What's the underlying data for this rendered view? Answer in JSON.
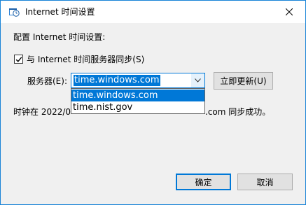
{
  "window": {
    "title": "Internet 时间设置",
    "close_icon": "close-icon",
    "app_icon": "clock-settings-icon"
  },
  "section": {
    "heading": "配置 Internet 时间设置:"
  },
  "sync": {
    "checkbox_checked": true,
    "checkbox_label": "与 Internet 时间服务器同步(S)"
  },
  "server": {
    "label": "服务器(E):",
    "value": "time.windows.com",
    "options": [
      "time.windows.com",
      "time.nist.gov"
    ],
    "selected_index": 0,
    "update_button": "立即更新(U)"
  },
  "status": {
    "visible_prefix": "时钟在 2022/0",
    "visible_suffix": ".com 同步成功。"
  },
  "buttons": {
    "ok": "确定",
    "cancel": "取消"
  },
  "colors": {
    "accent": "#0078d7",
    "window_border": "#1883d7",
    "dialog_bg": "#f0f0f0",
    "button_bg": "#e1e1e1"
  }
}
